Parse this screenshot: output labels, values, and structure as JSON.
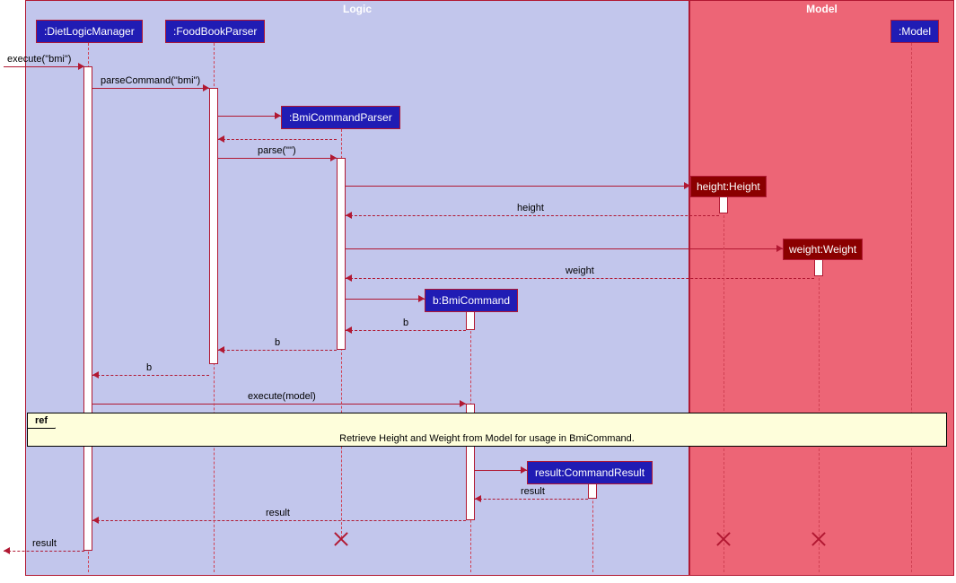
{
  "regions": {
    "logic": "Logic",
    "model": "Model"
  },
  "participants": {
    "dlm": ":DietLogicManager",
    "fbp": ":FoodBookParser",
    "bcp": ":BmiCommandParser",
    "bc": "b:BmiCommand",
    "height": "height:Height",
    "weight": "weight:Weight",
    "result": "result:CommandResult",
    "model": ":Model"
  },
  "messages": {
    "execute_in": "execute(\"bmi\")",
    "parseCommand": "parseCommand(\"bmi\")",
    "parse": "parse(\"\")",
    "height_ret": "height",
    "weight_ret": "weight",
    "b_ret1": "b",
    "b_ret2": "b",
    "b_ret3": "b",
    "execute_model": "execute(model)",
    "result_ret1": "result",
    "result_ret2": "result",
    "result_out": "result"
  },
  "ref": {
    "label": "ref",
    "text": "Retrieve Height and Weight from Model for usage in BmiCommand."
  }
}
